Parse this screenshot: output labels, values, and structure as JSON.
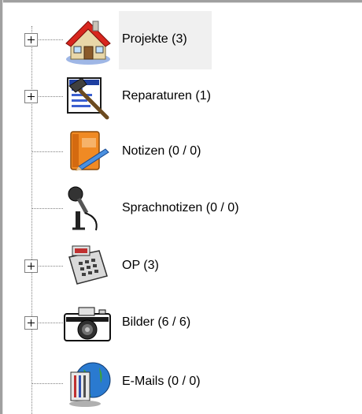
{
  "tree": {
    "items": [
      {
        "label": "Projekte (3)",
        "icon": "house-icon",
        "expandable": true,
        "selected": true
      },
      {
        "label": "Reparaturen (1)",
        "icon": "repair-hammer-icon",
        "expandable": true,
        "selected": false
      },
      {
        "label": "Notizen (0 / 0)",
        "icon": "notebook-icon",
        "expandable": false,
        "selected": false
      },
      {
        "label": "Sprachnotizen (0 / 0)",
        "icon": "microphone-icon",
        "expandable": false,
        "selected": false
      },
      {
        "label": "OP (3)",
        "icon": "cash-register-icon",
        "expandable": true,
        "selected": false
      },
      {
        "label": "Bilder (6 / 6)",
        "icon": "camera-icon",
        "expandable": true,
        "selected": false
      },
      {
        "label": "E-Mails (0 / 0)",
        "icon": "email-globe-icon",
        "expandable": false,
        "selected": false
      }
    ]
  },
  "colors": {
    "line": "#808080",
    "selection": "#f0f0f0",
    "text": "#000000"
  }
}
